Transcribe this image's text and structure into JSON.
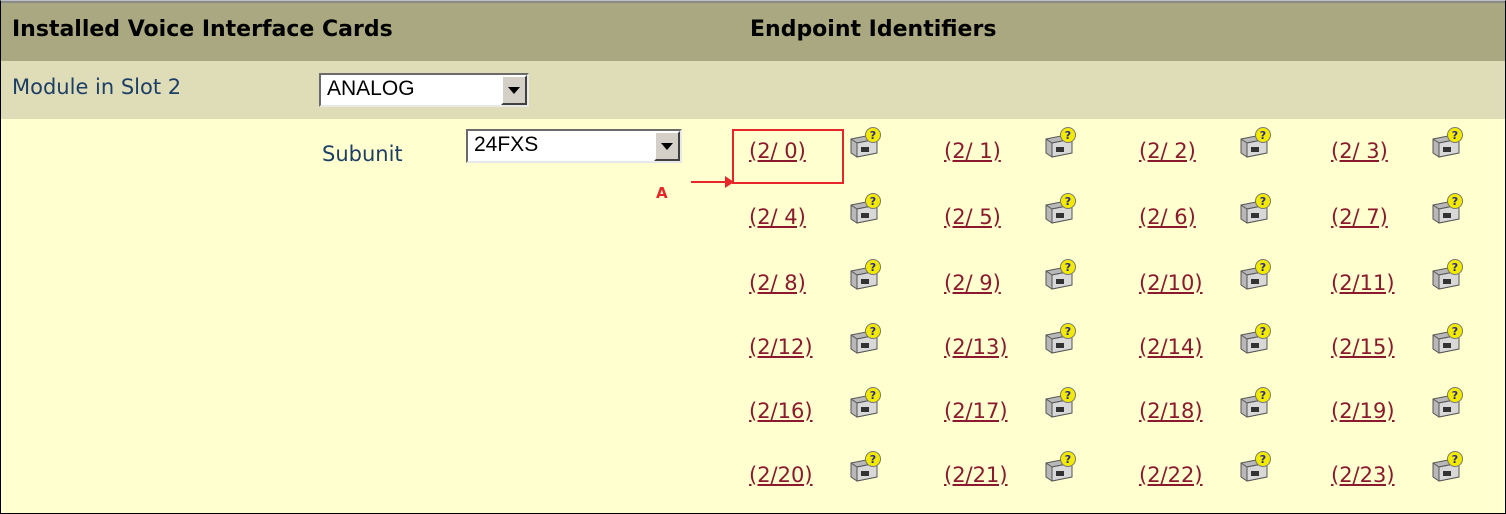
{
  "header": {
    "installed_cards": "Installed Voice Interface Cards",
    "endpoint_identifiers": "Endpoint Identifiers"
  },
  "module": {
    "label": "Module in Slot 2",
    "selected": "ANALOG"
  },
  "subunit": {
    "label": "Subunit",
    "selected": "24FXS"
  },
  "callout": {
    "label": "A",
    "color": "#e8262a"
  },
  "endpoint_icon": "phone-port-help-icon",
  "endpoints": [
    "(2/ 0)",
    "(2/ 1)",
    "(2/ 2)",
    "(2/ 3)",
    "(2/ 4)",
    "(2/ 5)",
    "(2/ 6)",
    "(2/ 7)",
    "(2/ 8)",
    "(2/ 9)",
    "(2/10)",
    "(2/11)",
    "(2/12)",
    "(2/13)",
    "(2/14)",
    "(2/15)",
    "(2/16)",
    "(2/17)",
    "(2/18)",
    "(2/19)",
    "(2/20)",
    "(2/21)",
    "(2/22)",
    "(2/23)"
  ]
}
